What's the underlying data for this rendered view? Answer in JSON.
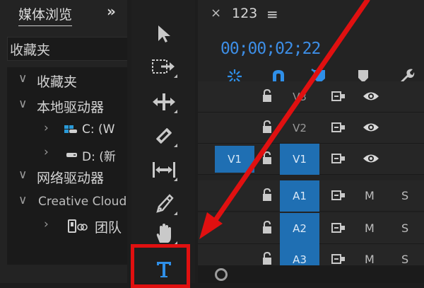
{
  "media_browser": {
    "tab_label": "媒体浏览",
    "more_icon": "double-chevron-right-icon",
    "search_value": "收藏夹",
    "tree": [
      {
        "label": "收藏夹",
        "expanded": true,
        "level": 0
      },
      {
        "label": "本地驱动器",
        "expanded": true,
        "level": 0
      },
      {
        "label": "C: (W",
        "level": 1,
        "icon": "windows-drive-icon"
      },
      {
        "label": "D: (新",
        "level": 1,
        "icon": "drive-icon"
      },
      {
        "label": "网络驱动器",
        "expanded": true,
        "level": 0
      },
      {
        "label": "Creative Cloud",
        "expanded": true,
        "level": 0
      },
      {
        "label": "团队",
        "level": 1,
        "icon": "team-project-icon"
      }
    ]
  },
  "tools": [
    {
      "name": "selection-tool",
      "icon": "arrow-pointer-icon"
    },
    {
      "name": "track-select-tool",
      "icon": "track-select-forward-icon"
    },
    {
      "name": "ripple-edit-tool",
      "icon": "ripple-edit-icon"
    },
    {
      "name": "razor-tool",
      "icon": "razor-icon"
    },
    {
      "name": "slip-tool",
      "icon": "slip-icon"
    },
    {
      "name": "pen-tool",
      "icon": "pen-icon"
    },
    {
      "name": "hand-tool",
      "icon": "hand-icon"
    },
    {
      "name": "type-tool",
      "icon": "type-t-icon",
      "selected": true
    }
  ],
  "timeline": {
    "sequence_name": "123",
    "close_glyph": "×",
    "menu_glyph": "≡",
    "timecode": "00;00;02;22",
    "toolbar_icons": [
      "snap-icon",
      "linked-selection-magnet-icon",
      "add-marker-icon",
      "marker-icon",
      "wrench-icon"
    ],
    "tracks": [
      {
        "id": "V3",
        "kind": "video",
        "target_label": "V3",
        "source_label": "",
        "target_active": false
      },
      {
        "id": "V2",
        "kind": "video",
        "target_label": "V2",
        "source_label": "",
        "target_active": false
      },
      {
        "id": "V1",
        "kind": "video",
        "target_label": "V1",
        "source_label": "V1",
        "target_active": true
      },
      {
        "id": "A1",
        "kind": "audio",
        "target_label": "A1",
        "source_label": "",
        "target_active": true,
        "mute": "M",
        "solo": "S"
      },
      {
        "id": "A2",
        "kind": "audio",
        "target_label": "A2",
        "source_label": "",
        "target_active": true,
        "mute": "M",
        "solo": "S"
      },
      {
        "id": "A3",
        "kind": "audio",
        "target_label": "A3",
        "source_label": "",
        "target_active": true,
        "mute": "M",
        "solo": "S"
      }
    ]
  },
  "colors": {
    "accent_blue": "#1f6fb3",
    "timecode_blue": "#3d8ee6",
    "annotation_red": "#e01010"
  }
}
